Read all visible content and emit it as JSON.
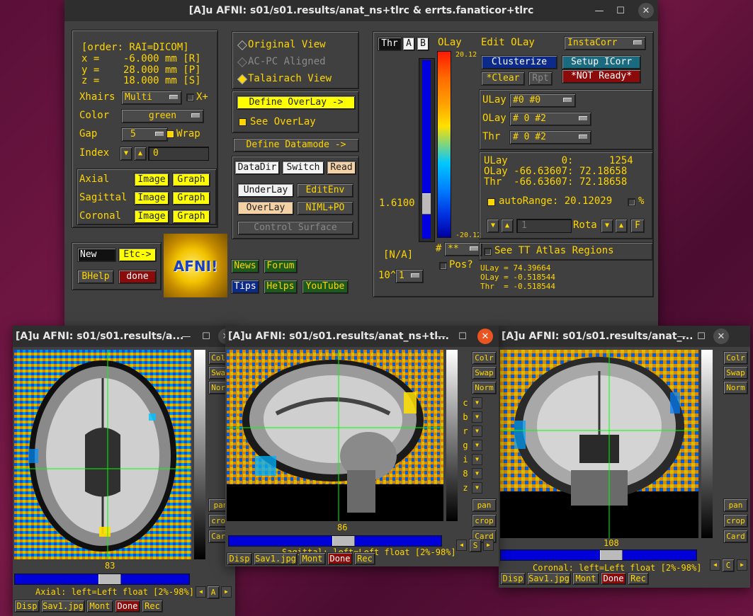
{
  "main_window": {
    "title": "[A]u AFNI: s01/s01.results/anat_ns+tlrc & errts.fanaticor+tlrc",
    "coords": {
      "order": "[order: RAI=DICOM]",
      "x": "x =    -6.000 mm [R]",
      "y": "y =    28.000 mm [P]",
      "z": "z =    18.000 mm [S]"
    },
    "xhairs_label": "Xhairs",
    "xhairs_value": "Multi",
    "xplus_label": "X+",
    "color_label": "Color",
    "color_value": "green",
    "gap_label": "Gap",
    "gap_value": "5",
    "wrap_label": "Wrap",
    "index_label": "Index",
    "index_value": "0",
    "views": [
      {
        "label": "Axial",
        "image": "Image",
        "graph": "Graph"
      },
      {
        "label": "Sagittal",
        "image": "Image",
        "graph": "Graph"
      },
      {
        "label": "Coronal",
        "image": "Image",
        "graph": "Graph"
      }
    ],
    "new_label": "New",
    "etc_label": "Etc->",
    "bhelp_label": "BHelp",
    "done_label": "done",
    "logo_text": "AFNI!",
    "original_view": "Original View",
    "acpc_aligned": "AC-PC Aligned",
    "talairach_view": "Talairach View",
    "define_overlay": "Define OverLay ->",
    "see_overlay": "See OverLay",
    "define_datamode": "Define Datamode ->",
    "datadir": "DataDir",
    "switch": "Switch",
    "read": "Read",
    "underlay": "UnderLay",
    "editenv": "EditEnv",
    "overlay": "OverLay",
    "niml_po": "NIML+PO",
    "control_surface": "Control Surface",
    "news": "News",
    "forum": "Forum",
    "tips": "Tips",
    "helps": "Helps",
    "youtube": "YouTube",
    "thr_label": "Thr",
    "a_label": "A",
    "b_label": "B",
    "olay_label": "OLay",
    "olay_max": "20.12",
    "olay_min": "-20.12",
    "thr_value": "1.6100",
    "na_label": "[N/A]",
    "exp_label": "10^",
    "exp_value": "1",
    "pbar_count": "**",
    "hash_label": "#",
    "pos_label": "Pos?",
    "edit_olay": "Edit OLay",
    "instacorr": "InstaCorr",
    "clusterize": "Clusterize",
    "setup_icorr": "Setup ICorr",
    "clear": "*Clear",
    "rpt": "Rpt",
    "not_ready": "*NOT Ready*",
    "ulay_label": "ULay",
    "ulay_value": "#0 #0",
    "olay_sel_label": "OLay",
    "olay_sel_value": "#  0 #2",
    "thr_sel_label": "Thr",
    "thr_sel_value": "#  0 #2",
    "readout": {
      "ulay": "ULay         0:      1254",
      "olay": "OLay -66.63607: 72.18658",
      "thr": "Thr  -66.63607: 72.18658"
    },
    "autorange": "autoRange: 20.12029",
    "percent_label": "%",
    "rota_label": "Rota",
    "rota_field": "1",
    "f_label": "F",
    "see_tt_atlas": "See TT Atlas Regions",
    "bottom_vals": {
      "ulay": "ULay = 74.39664",
      "olay": "OLay = -0.518544",
      "thr": "Thr  = -0.518544"
    }
  },
  "image_windows": [
    {
      "title": "[A]u AFNI: s01/s01.results/a...",
      "slice": "83",
      "info": "Axial: left=Left float [2%-98%]",
      "orient_letter": "A",
      "bottom": [
        "Disp",
        "Sav1.jpg",
        "Mont",
        "Done",
        "Rec"
      ]
    },
    {
      "title": "[A]u AFNI: s01/s01.results/anat_ns+tl...",
      "slice": "86",
      "info": "Sagittal: left=Left float [2%-98%]",
      "orient_letter": "S",
      "bottom": [
        "Disp",
        "Sav1.jpg",
        "Mont",
        "Done",
        "Rec"
      ]
    },
    {
      "title": "[A]u AFNI: s01/s01.results/anat_...",
      "slice": "108",
      "info": "Coronal: left=Left float [2%-98%]",
      "orient_letter": "C",
      "bottom": [
        "Disp",
        "Sav1.jpg",
        "Mont",
        "Done",
        "Rec"
      ]
    }
  ],
  "side_buttons": [
    "Colr",
    "Swap",
    "Norm"
  ],
  "side_letters": [
    "c",
    "b",
    "r",
    "g",
    "i",
    "8",
    "z"
  ],
  "side_bottom": [
    "pan",
    "crop",
    "Card"
  ],
  "colors": {
    "accent_yellow": "#ffd600",
    "crosshair_green": "#00ff00",
    "panel_bg": "#404040"
  }
}
